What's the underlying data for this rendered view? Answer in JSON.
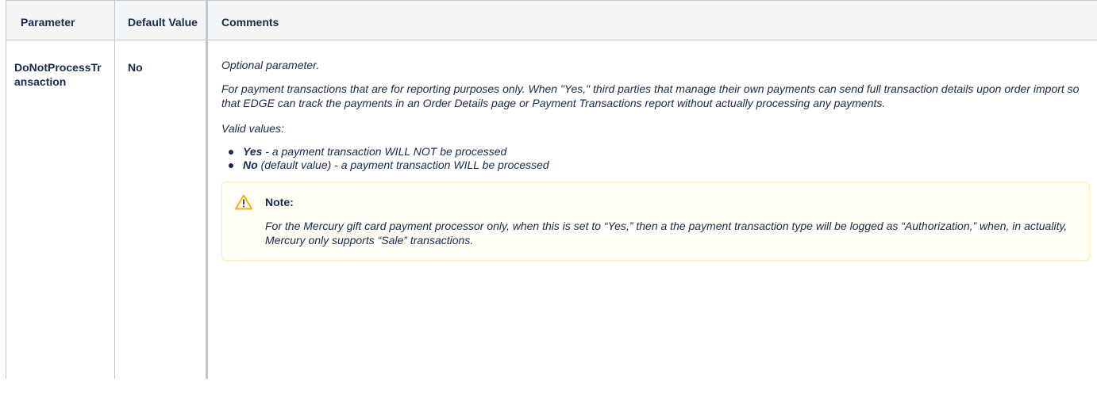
{
  "table": {
    "headers": {
      "parameter": "Parameter",
      "default_value": "Default Value",
      "comments": "Comments"
    },
    "rows": [
      {
        "parameter": "DoNotProcessTransaction",
        "default_value": "No",
        "comments": {
          "intro": "Optional parameter.",
          "description": "For payment transactions that are for reporting purposes only. When \"Yes,\" third parties that manage their own payments can send full transaction details upon order import so that EDGE can track the payments in an Order Details page or Payment Transactions report without actually processing any payments.",
          "valid_values_label": "Valid values:",
          "values": [
            {
              "value": "Yes",
              "text": " - a payment transaction WILL NOT be processed"
            },
            {
              "value": "No",
              "text": " (default value) - a payment transaction WILL be processed"
            }
          ],
          "note": {
            "icon": "warning-icon",
            "title": "Note:",
            "body": "For the Mercury gift card payment processor only, when this is set to “Yes,” then a the payment transaction type will be logged as “Authorization,” when, in actuality, Mercury only supports “Sale” transactions."
          }
        }
      }
    ]
  },
  "colors": {
    "border": "#c1c7d0",
    "header_bg": "#f4f5f7",
    "note_bg": "#fffdf6",
    "note_border": "#ffeeb3",
    "warning_icon": "#f5b400"
  }
}
